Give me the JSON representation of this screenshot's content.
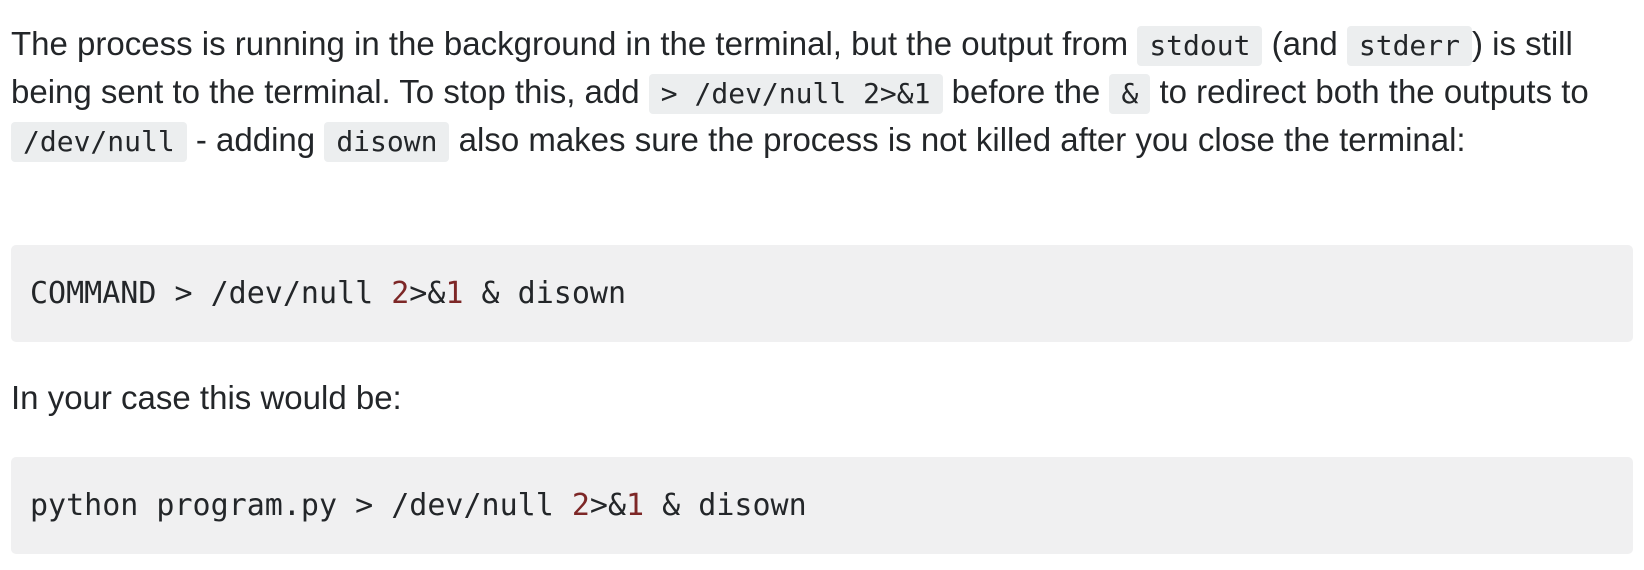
{
  "paragraph1": {
    "t1": "The process is running in the background in the terminal, but the output from ",
    "c1": "stdout",
    "t2": " (and ",
    "c2": "stderr",
    "t3": ") is still being sent to the terminal. To stop this, add ",
    "c3": "> /dev/null 2>&1",
    "t4": " before the ",
    "c4": "&",
    "t5": " to redirect both the outputs to ",
    "c5": "/dev/null",
    "t6": " - adding ",
    "c6": "disown",
    "t7": " also makes sure the process is not killed after you close the terminal:"
  },
  "code_block_1": {
    "pre": "COMMAND > /dev/null ",
    "n1": "2",
    "mid": ">&",
    "n2": "1",
    "post": " & disown"
  },
  "paragraph2": {
    "text": "In your case this would be:"
  },
  "code_block_2": {
    "pre": "python program.py > /dev/null ",
    "n1": "2",
    "mid": ">&",
    "n2": "1",
    "post": " & disown"
  }
}
